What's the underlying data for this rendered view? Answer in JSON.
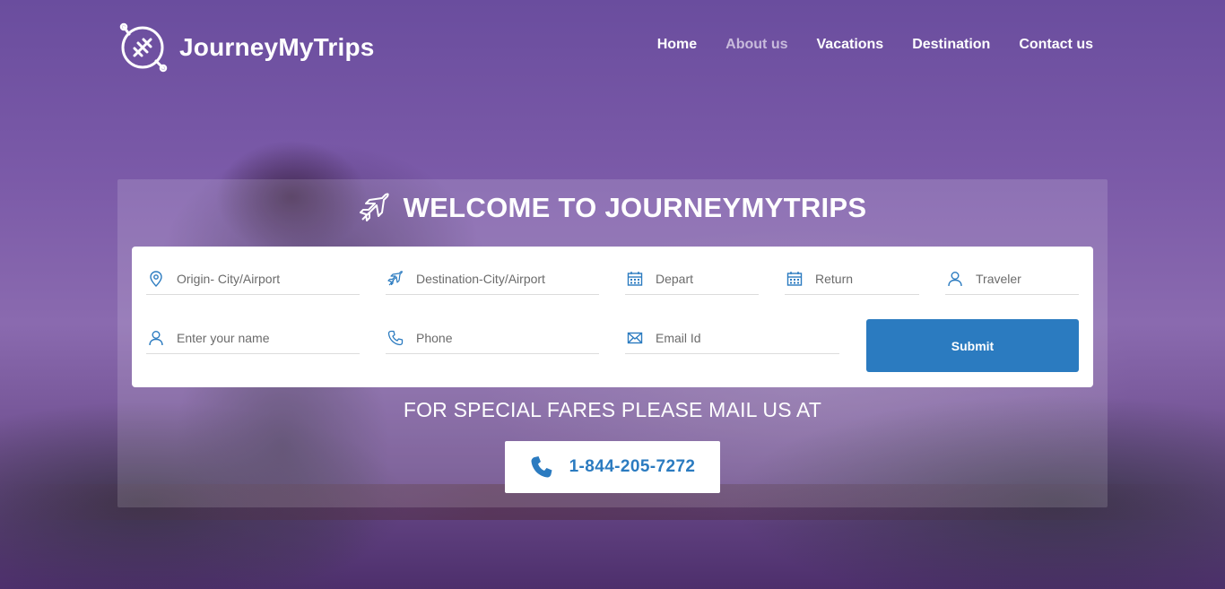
{
  "brand": {
    "name": "JourneyMyTrips",
    "logo_icon": "plane-circle-icon"
  },
  "nav": {
    "items": [
      {
        "label": "Home",
        "state": "normal"
      },
      {
        "label": "About us",
        "state": "muted"
      },
      {
        "label": "Vacations",
        "state": "normal"
      },
      {
        "label": "Destination",
        "state": "normal"
      },
      {
        "label": "Contact us",
        "state": "normal"
      }
    ]
  },
  "hero": {
    "title": "WELCOME TO JOURNEYMYTRIPS",
    "title_icon": "airplane-icon"
  },
  "form": {
    "origin": {
      "placeholder": "Origin- City/Airport",
      "icon": "location-pin-icon"
    },
    "destination": {
      "placeholder": "Destination-City/Airport",
      "icon": "airplane-icon"
    },
    "depart": {
      "placeholder": "Depart",
      "icon": "calendar-icon"
    },
    "return": {
      "placeholder": "Return",
      "icon": "calendar-icon"
    },
    "traveler": {
      "placeholder": "Traveler",
      "icon": "user-icon"
    },
    "name": {
      "placeholder": "Enter your name",
      "icon": "user-icon"
    },
    "phone": {
      "placeholder": "Phone",
      "icon": "phone-icon"
    },
    "email": {
      "placeholder": "Email Id",
      "icon": "envelope-icon"
    },
    "submit_label": "Submit"
  },
  "fares": {
    "text": "FOR SPECIAL FARES PLEASE MAIL US AT",
    "phone_number": "1-844-205-7272",
    "phone_icon": "phone-icon"
  },
  "colors": {
    "accent": "#2b7bc0",
    "overlay": "#6a4d9e",
    "white": "#ffffff"
  }
}
